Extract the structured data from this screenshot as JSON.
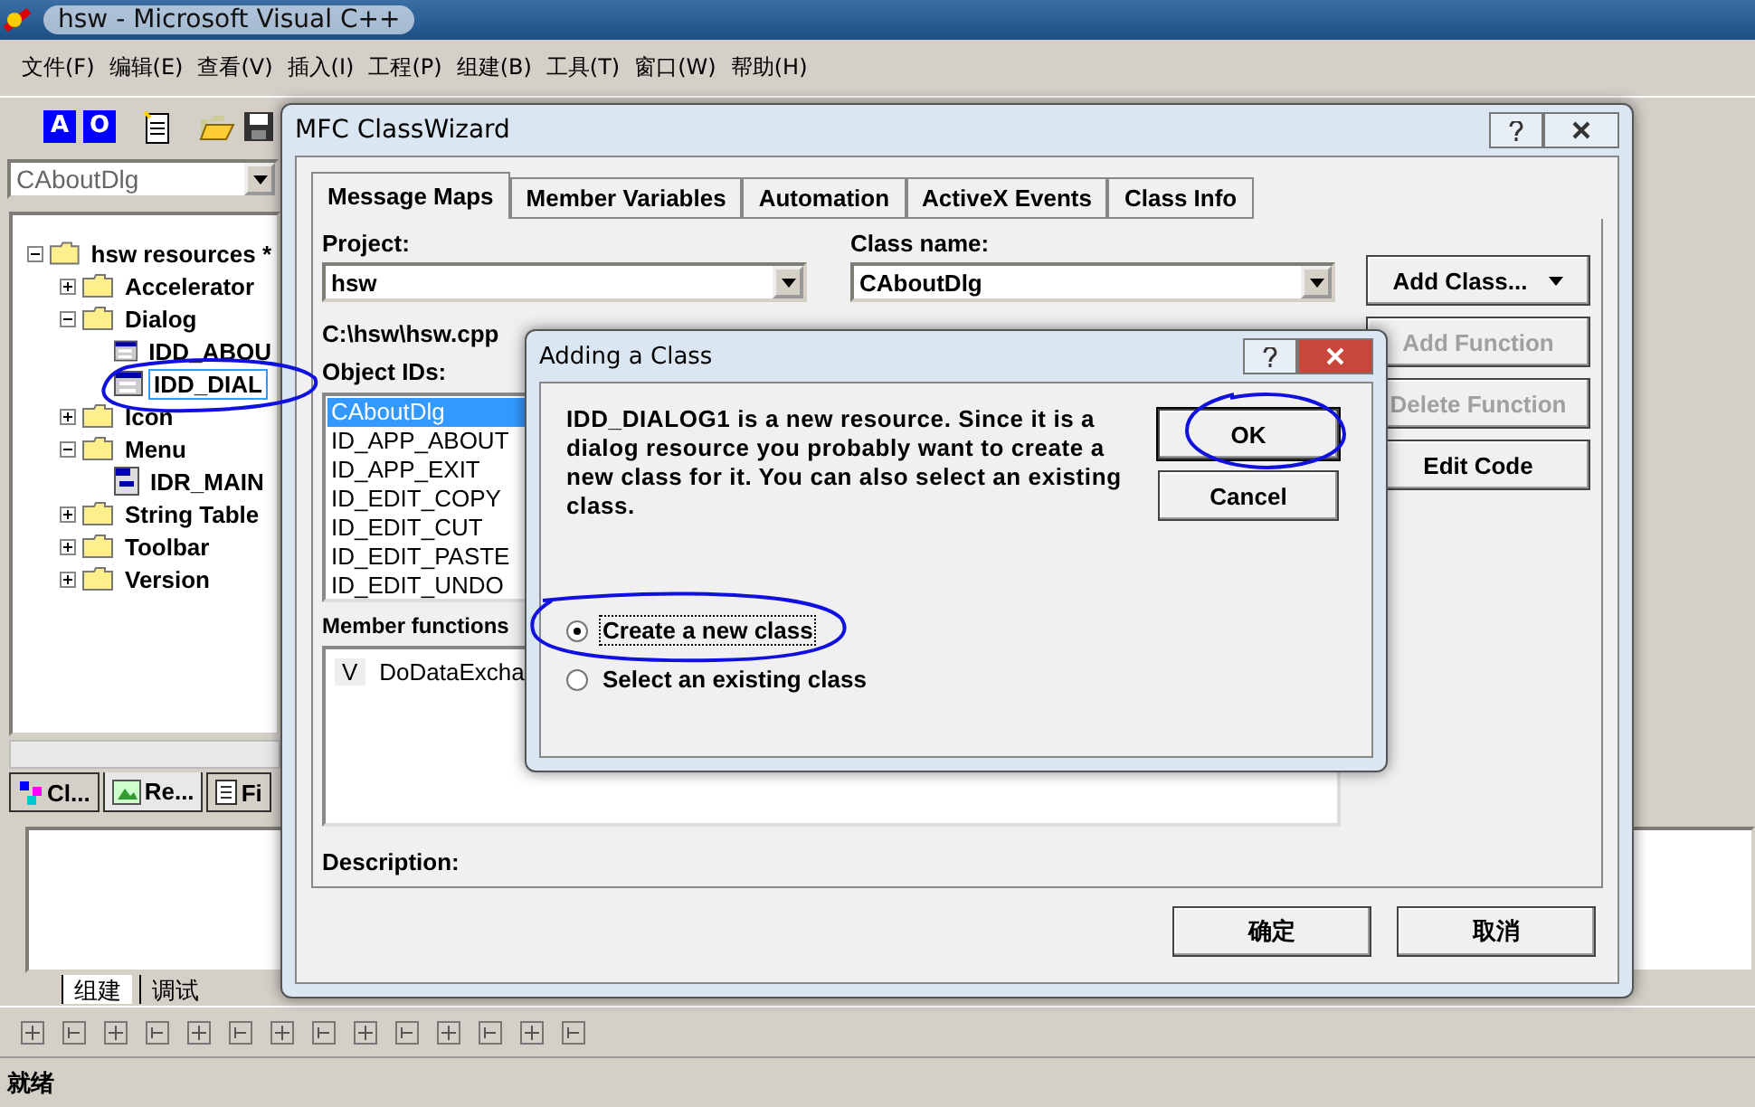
{
  "main_window": {
    "title": "hsw - Microsoft Visual C++"
  },
  "menu": [
    "文件(F)",
    "编辑(E)",
    "查看(V)",
    "插入(I)",
    "工程(P)",
    "组建(B)",
    "工具(T)",
    "窗口(W)",
    "帮助(H)"
  ],
  "toolbar": {
    "buttons": [
      "A",
      "O"
    ]
  },
  "class_combo": {
    "value": "CAboutDlg"
  },
  "tree": [
    {
      "label": "hsw resources *",
      "kind": "root",
      "expanded": true,
      "selected": false,
      "children": [
        {
          "label": "Accelerator",
          "kind": "folder",
          "expanded": false,
          "selected": false
        },
        {
          "label": "Dialog",
          "kind": "folder",
          "expanded": true,
          "selected": false,
          "children": [
            {
              "label": "IDD_ABOU",
              "kind": "dialog",
              "selected": false
            },
            {
              "label": "IDD_DIAL",
              "kind": "dialog",
              "selected": true
            }
          ]
        },
        {
          "label": "Icon",
          "kind": "folder",
          "expanded": false,
          "selected": false
        },
        {
          "label": "Menu",
          "kind": "folder",
          "expanded": true,
          "selected": false,
          "children": [
            {
              "label": "IDR_MAIN",
              "kind": "menu",
              "selected": false
            }
          ]
        },
        {
          "label": "String Table",
          "kind": "folder",
          "expanded": false,
          "selected": false
        },
        {
          "label": "Toolbar",
          "kind": "folder",
          "expanded": false,
          "selected": false
        },
        {
          "label": "Version",
          "kind": "folder",
          "expanded": false,
          "selected": false
        }
      ]
    }
  ],
  "workspace_tabs": [
    {
      "label": "Cl...",
      "kind": "class",
      "selected": false
    },
    {
      "label": "Re...",
      "kind": "resource",
      "selected": true
    },
    {
      "label": "Fi",
      "kind": "file",
      "selected": false
    }
  ],
  "output_tabs": [
    {
      "label": "组建",
      "selected": true
    },
    {
      "label": "调试",
      "selected": false
    }
  ],
  "status_bar": {
    "text": "就绪"
  },
  "class_wizard": {
    "title": "MFC ClassWizard",
    "tabs": [
      {
        "label": "Message Maps",
        "selected": true
      },
      {
        "label": "Member Variables",
        "selected": false
      },
      {
        "label": "Automation",
        "selected": false
      },
      {
        "label": "ActiveX Events",
        "selected": false
      },
      {
        "label": "Class Info",
        "selected": false
      }
    ],
    "project": {
      "label": "Project:",
      "value": "hsw"
    },
    "class_name": {
      "label": "Class name:",
      "value": "CAboutDlg"
    },
    "path": "C:\\hsw\\hsw.cpp",
    "object_ids": {
      "label": "Object IDs:",
      "items": [
        {
          "text": "CAboutDlg",
          "selected": true
        },
        {
          "text": "ID_APP_ABOUT",
          "selected": false
        },
        {
          "text": "ID_APP_EXIT",
          "selected": false
        },
        {
          "text": "ID_EDIT_COPY",
          "selected": false
        },
        {
          "text": "ID_EDIT_CUT",
          "selected": false
        },
        {
          "text": "ID_EDIT_PASTE",
          "selected": false
        },
        {
          "text": "ID_EDIT_UNDO",
          "selected": false
        }
      ]
    },
    "member_functions": {
      "label": "Member functions",
      "items": [
        {
          "prefix": "V",
          "name": "DoDataExcha"
        }
      ]
    },
    "side_buttons": [
      {
        "label": "Add Class...",
        "kind": "dropdown",
        "disabled": false
      },
      {
        "label": "Add Function",
        "kind": "plain",
        "disabled": true
      },
      {
        "label": "Delete Function",
        "kind": "plain",
        "disabled": true
      },
      {
        "label": "Edit Code",
        "kind": "plain",
        "disabled": false
      }
    ],
    "description_label": "Description:",
    "buttons": [
      "确定",
      "取消"
    ]
  },
  "adding_dialog": {
    "title": "Adding a Class",
    "message": "IDD_DIALOG1 is a new resource.  Since it is a dialog resource you probably want to create a new class for it.  You can also select an existing class.",
    "buttons": [
      {
        "label": "OK",
        "default": true
      },
      {
        "label": "Cancel",
        "default": false
      }
    ],
    "options": [
      {
        "label": "Create a new class",
        "selected": true
      },
      {
        "label": "Select an existing class",
        "selected": false
      }
    ]
  }
}
